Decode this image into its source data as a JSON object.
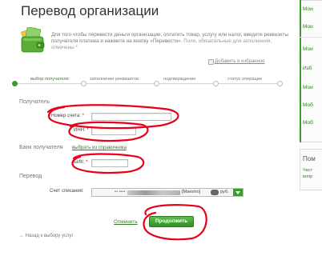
{
  "page": {
    "title": "Перевод организации"
  },
  "intro": {
    "text": "Для того чтобы перевести деньги организации, оплатить товар, услугу или налог, введите реквизиты получателя платежа и нажмите на кнопку «Перевести».",
    "required_note": "Поля, обязательные для заполнения, отмечены *"
  },
  "favorites_link": "Добавить в избранное",
  "steps": [
    {
      "label": "выбор получателя",
      "active": true
    },
    {
      "label": "заполнение реквизитов",
      "active": false
    },
    {
      "label": "подтверждение",
      "active": false
    },
    {
      "label": "статус операции",
      "active": false
    }
  ],
  "recipient": {
    "section": "Получатель",
    "account_label": "Номер счета:",
    "inn_label": "ИНН:",
    "account_value": "",
    "inn_value": ""
  },
  "bank": {
    "section": "Банк получателя",
    "ref_link": "выбрать из справочника",
    "bik_label": "БИК:",
    "bik_value": ""
  },
  "transfer": {
    "section": "Перевод",
    "account_label": "Счет списания:",
    "account_mask": "•• ••••",
    "card_type": "[Maestro]",
    "currency": "руб."
  },
  "actions": {
    "cancel": "Отменить",
    "continue": "Продолжить",
    "back": "← Назад к выбору услуг"
  },
  "sidebar": {
    "links": [
      "Мои",
      "Мои",
      "Мои",
      "Изб",
      "Мои",
      "Моб",
      "Моб"
    ],
    "card_title": "Пом",
    "card_lines": [
      "Част",
      "вопр"
    ]
  },
  "colors": {
    "accent": "#3d9a2f",
    "annotation": "#e8001b"
  }
}
